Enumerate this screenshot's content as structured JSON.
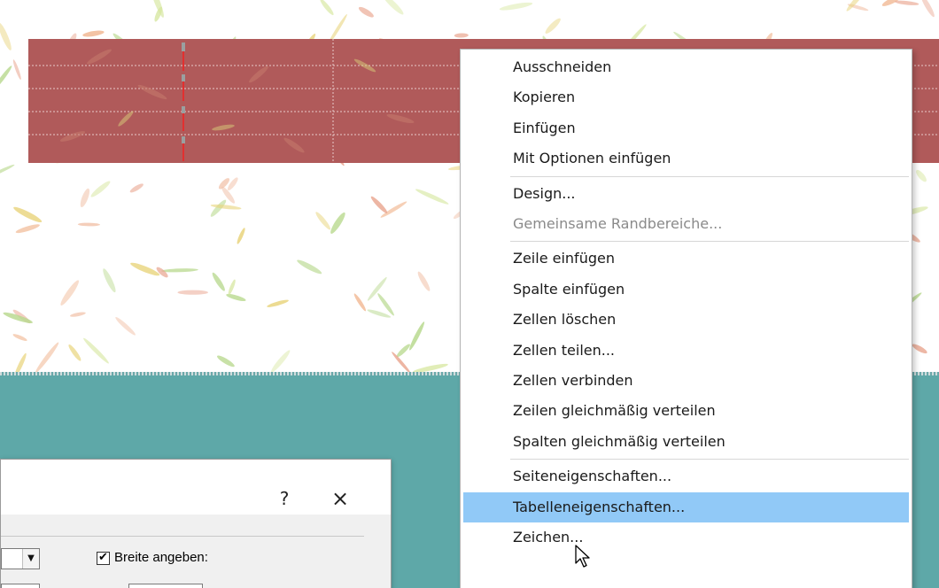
{
  "context_menu": {
    "groups": [
      [
        {
          "label": "Ausschneiden",
          "state": "normal"
        },
        {
          "label": "Kopieren",
          "state": "normal"
        },
        {
          "label": "Einfügen",
          "state": "normal"
        },
        {
          "label": "Mit Optionen einfügen",
          "state": "normal"
        }
      ],
      [
        {
          "label": "Design...",
          "state": "normal"
        },
        {
          "label": "Gemeinsame Randbereiche...",
          "state": "disabled"
        }
      ],
      [
        {
          "label": "Zeile einfügen",
          "state": "normal"
        },
        {
          "label": "Spalte einfügen",
          "state": "normal"
        },
        {
          "label": "Zellen löschen",
          "state": "normal"
        },
        {
          "label": "Zellen teilen...",
          "state": "normal"
        },
        {
          "label": "Zellen verbinden",
          "state": "normal"
        },
        {
          "label": "Zeilen gleichmäßig verteilen",
          "state": "normal"
        },
        {
          "label": "Spalten gleichmäßig verteilen",
          "state": "normal"
        }
      ],
      [
        {
          "label": "Seiteneigenschaften...",
          "state": "normal"
        },
        {
          "label": "Tabelleneigenschaften...",
          "state": "highlighted"
        },
        {
          "label": "Zeichen...",
          "state": "normal"
        }
      ]
    ]
  },
  "dialog": {
    "help_label": "?",
    "close_label": "×",
    "checkbox_label": "Breite angeben:",
    "checkbox_mark": "✔",
    "dropdown_arrow": "▼"
  },
  "colors": {
    "table_red": "#b05a5a",
    "teal": "#5ea8a8",
    "menu_highlight": "#91c9f7",
    "menu_disabled_text": "#8a8a8a"
  },
  "icons": {
    "cursor": "arrow-pointer-icon",
    "dialog_close": "close-icon",
    "dialog_help": "help-icon",
    "dropdown": "chevron-down-icon"
  }
}
